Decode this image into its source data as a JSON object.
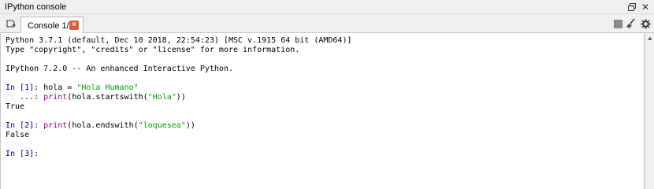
{
  "pane": {
    "title": "IPython console",
    "undock_icon": "undock-icon",
    "close_icon": "close-icon"
  },
  "tabs": [
    {
      "label": "Console 1/A",
      "active": true
    }
  ],
  "toolbar": {
    "stop": "stop-icon",
    "clear": "broom-icon",
    "options": "gear-icon"
  },
  "console": {
    "banner1": "Python 3.7.1 (default, Dec 10 2018, 22:54:23) [MSC v.1915 64 bit (AMD64)]",
    "banner2": "Type \"copyright\", \"credits\" or \"license\" for more information.",
    "banner3": "IPython 7.2.0 -- An enhanced Interactive Python.",
    "cell1": {
      "prompt": "In [1]:",
      "line1_code": "hola = ",
      "line1_str": "\"Hola Humano\"",
      "cont_prompt": "   ...:",
      "line2_fn": "print",
      "line2_mid": "(hola.startswith(",
      "line2_str": "\"Hola\"",
      "line2_end": "))",
      "output": "True"
    },
    "cell2": {
      "prompt": "In [2]:",
      "fn": "print",
      "mid": "(hola.endswith(",
      "str": "\"loquesea\"",
      "end": "))",
      "output": "False"
    },
    "cell3": {
      "prompt": "In [3]:"
    }
  },
  "colors": {
    "prompt": "#000080",
    "builtin": "#900090",
    "string": "#00a000",
    "tab_close": "#e05a36"
  }
}
